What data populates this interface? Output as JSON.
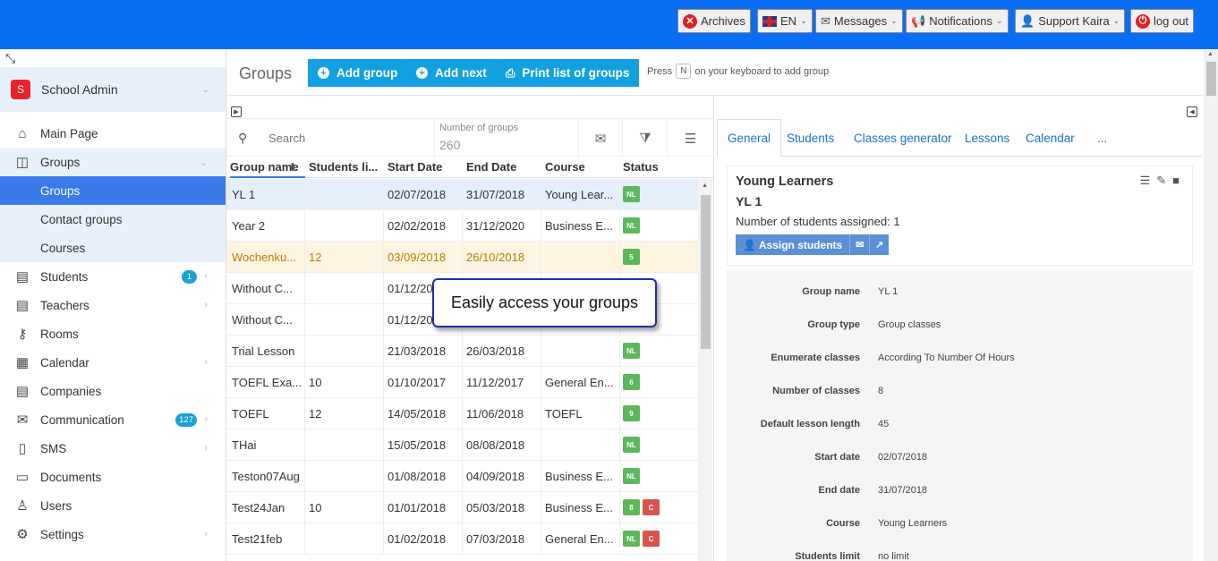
{
  "topbar": {
    "buttons": [
      {
        "label": "Archives",
        "icon": "close-circle-icon"
      },
      {
        "label": "EN",
        "icon": "uk-flag-icon"
      },
      {
        "label": "Messages",
        "icon": "envelope-icon"
      },
      {
        "label": "Notifications",
        "icon": "megaphone-icon"
      },
      {
        "label": "Support Kaira",
        "icon": "user-icon"
      },
      {
        "label": "log out",
        "icon": "power-icon"
      }
    ],
    "bg_color": "#0a6ef5"
  },
  "sidebar": {
    "profile": {
      "initial": "S",
      "name": "School Admin"
    },
    "items": [
      {
        "label": "Main Page",
        "icon": "home-icon"
      },
      {
        "label": "Groups",
        "icon": "cube-icon"
      },
      {
        "label": "Groups"
      },
      {
        "label": "Contact groups"
      },
      {
        "label": "Courses"
      },
      {
        "label": "Students",
        "icon": "id-card-icon",
        "badge": "1"
      },
      {
        "label": "Teachers",
        "icon": "id-card-icon"
      },
      {
        "label": "Rooms",
        "icon": "key-icon"
      },
      {
        "label": "Calendar",
        "icon": "calendar-icon"
      },
      {
        "label": "Companies",
        "icon": "id-card-icon"
      },
      {
        "label": "Communication",
        "icon": "envelope-icon",
        "badge": "127"
      },
      {
        "label": "SMS",
        "icon": "mobile-icon"
      },
      {
        "label": "Documents",
        "icon": "folder-icon"
      },
      {
        "label": "Users",
        "icon": "user-icon"
      },
      {
        "label": "Settings",
        "icon": "gear-icon"
      }
    ],
    "active_color": "#3a7ae8"
  },
  "header": {
    "title": "Groups",
    "add_group": "Add group",
    "add_next": "Add next",
    "print_list": "Print list of groups",
    "hint_press": "Press",
    "hint_key": "N",
    "hint_rest": "on your keyboard to add group",
    "button_color": "#12a1e0"
  },
  "list": {
    "search_placeholder": "Search",
    "count_label": "Number of groups",
    "count_value": "260",
    "columns": [
      "Group name",
      "Students li...",
      "Start Date",
      "End Date",
      "Course",
      "Status"
    ],
    "rows": [
      {
        "name": "YL 1",
        "limit": "",
        "start": "02/07/2018",
        "end": "31/07/2018",
        "course": "Young Lear...",
        "tags": [
          {
            "t": "NL",
            "c": "green"
          }
        ]
      },
      {
        "name": "Year 2",
        "limit": "",
        "start": "02/02/2018",
        "end": "31/12/2020",
        "course": "Business E...",
        "tags": [
          {
            "t": "NL",
            "c": "green"
          }
        ]
      },
      {
        "name": "Wochenku...",
        "limit": "12",
        "start": "03/09/2018",
        "end": "26/10/2018",
        "course": "",
        "tags": [
          {
            "t": "5",
            "c": "green"
          }
        ]
      },
      {
        "name": "Without C...",
        "limit": "",
        "start": "01/12/20",
        "end": "",
        "course": "",
        "tags": []
      },
      {
        "name": "Without C...",
        "limit": "",
        "start": "01/12/20",
        "end": "",
        "course": "",
        "tags": []
      },
      {
        "name": "Trial Lesson",
        "limit": "",
        "start": "21/03/2018",
        "end": "26/03/2018",
        "course": "",
        "tags": [
          {
            "t": "NL",
            "c": "green"
          }
        ]
      },
      {
        "name": "TOEFL Exa...",
        "limit": "10",
        "start": "01/10/2017",
        "end": "11/12/2017",
        "course": "General En...",
        "tags": [
          {
            "t": "6",
            "c": "green"
          }
        ]
      },
      {
        "name": "TOEFL",
        "limit": "12",
        "start": "14/05/2018",
        "end": "11/06/2018",
        "course": "TOEFL",
        "tags": [
          {
            "t": "9",
            "c": "green"
          }
        ]
      },
      {
        "name": "THai",
        "limit": "",
        "start": "15/05/2018",
        "end": "08/08/2018",
        "course": "",
        "tags": [
          {
            "t": "NL",
            "c": "green"
          }
        ]
      },
      {
        "name": "Teston07Aug",
        "limit": "",
        "start": "01/08/2018",
        "end": "04/09/2018",
        "course": "Business E...",
        "tags": [
          {
            "t": "NL",
            "c": "green"
          }
        ]
      },
      {
        "name": "Test24Jan",
        "limit": "10",
        "start": "01/01/2018",
        "end": "05/03/2018",
        "course": "Business E...",
        "tags": [
          {
            "t": "8",
            "c": "green"
          },
          {
            "t": "C",
            "c": "red"
          }
        ]
      },
      {
        "name": "Test21feb",
        "limit": "",
        "start": "01/02/2018",
        "end": "07/03/2018",
        "course": "General En...",
        "tags": [
          {
            "t": "NL",
            "c": "green"
          },
          {
            "t": "C",
            "c": "red"
          }
        ]
      }
    ]
  },
  "tooltip": {
    "text": "Easily access your groups"
  },
  "detail": {
    "tabs": [
      "General",
      "Students",
      "Classes generator",
      "Lessons",
      "Calendar",
      "..."
    ],
    "card": {
      "course": "Young Learners",
      "group": "YL 1",
      "students": "Number of students assigned: 1",
      "assign": "Assign students"
    },
    "fields": [
      {
        "label": "Group name",
        "value": "YL 1"
      },
      {
        "label": "Group type",
        "value": "Group classes"
      },
      {
        "label": "Enumerate classes",
        "value": "According To Number Of Hours"
      },
      {
        "label": "Number of classes",
        "value": "8"
      },
      {
        "label": "Default lesson length",
        "value": "45"
      },
      {
        "label": "Start date",
        "value": "02/07/2018"
      },
      {
        "label": "End date",
        "value": "31/07/2018"
      },
      {
        "label": "Course",
        "value": "Young Learners"
      },
      {
        "label": "Students limit",
        "value": "no limit"
      }
    ]
  }
}
